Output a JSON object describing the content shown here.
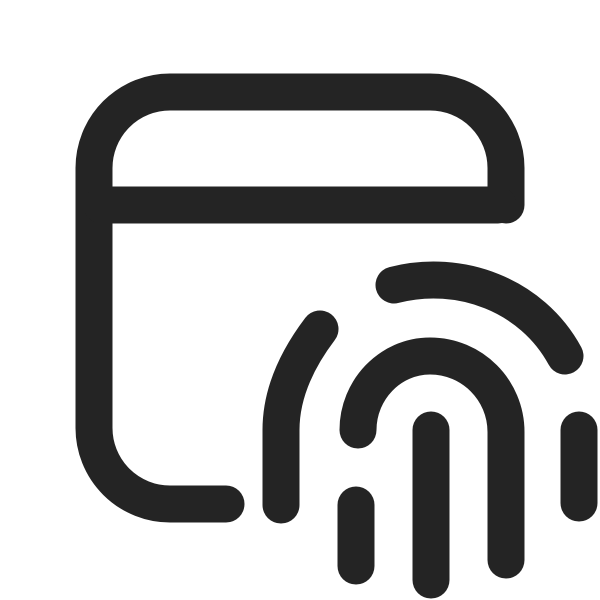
{
  "icon": {
    "name": "calendar-fingerprint-icon",
    "color": "#242424",
    "background": "#ffffff"
  }
}
